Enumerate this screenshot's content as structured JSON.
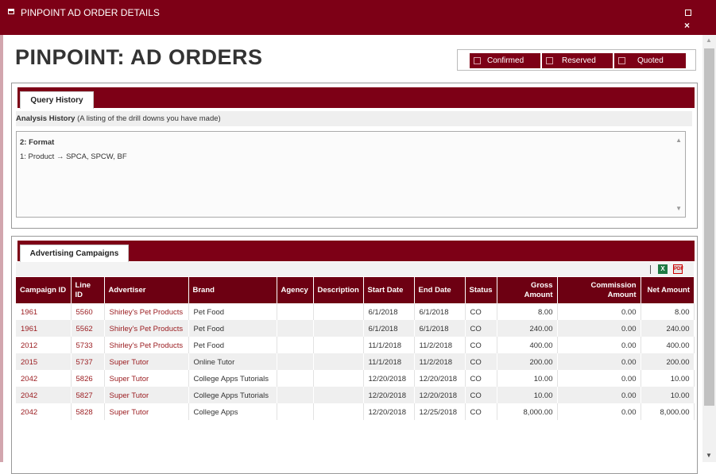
{
  "window": {
    "title": "PINPOINT AD ORDER DETAILS"
  },
  "page": {
    "title": "PINPOINT: AD ORDERS"
  },
  "legend": [
    {
      "label": "Confirmed"
    },
    {
      "label": "Reserved"
    },
    {
      "label": "Quoted"
    }
  ],
  "query_panel": {
    "tab_label": "Query History",
    "history_title": "Analysis History",
    "history_note": "(A listing of the drill downs you have made)",
    "items": [
      "2: Format",
      "1: Product  → SPCA, SPCW, BF"
    ]
  },
  "campaigns_panel": {
    "tab_label": "Advertising Campaigns",
    "export": {
      "excel_icon": "excel-icon",
      "pdf_icon": "pdf-icon",
      "excel_text": "X",
      "pdf_text": "PDF"
    },
    "columns": [
      "Campaign ID",
      "Line ID",
      "Advertiser",
      "Brand",
      "Agency",
      "Description",
      "Start Date",
      "End Date",
      "Status",
      "Gross Amount",
      "Commission Amount",
      "Net Amount"
    ],
    "rows": [
      {
        "campaign_id": "1961",
        "line_id": "5560",
        "advertiser": "Shirley's Pet Products",
        "brand": "Pet Food",
        "agency": "",
        "description": "",
        "start": "6/1/2018",
        "end": "6/1/2018",
        "status": "CO",
        "gross": "8.00",
        "commission": "0.00",
        "net": "8.00"
      },
      {
        "campaign_id": "1961",
        "line_id": "5562",
        "advertiser": "Shirley's Pet Products",
        "brand": "Pet Food",
        "agency": "",
        "description": "",
        "start": "6/1/2018",
        "end": "6/1/2018",
        "status": "CO",
        "gross": "240.00",
        "commission": "0.00",
        "net": "240.00"
      },
      {
        "campaign_id": "2012",
        "line_id": "5733",
        "advertiser": "Shirley's Pet Products",
        "brand": "Pet Food",
        "agency": "",
        "description": "",
        "start": "11/1/2018",
        "end": "11/2/2018",
        "status": "CO",
        "gross": "400.00",
        "commission": "0.00",
        "net": "400.00"
      },
      {
        "campaign_id": "2015",
        "line_id": "5737",
        "advertiser": "Super Tutor",
        "brand": "Online Tutor",
        "agency": "",
        "description": "",
        "start": "11/1/2018",
        "end": "11/2/2018",
        "status": "CO",
        "gross": "200.00",
        "commission": "0.00",
        "net": "200.00"
      },
      {
        "campaign_id": "2042",
        "line_id": "5826",
        "advertiser": "Super Tutor",
        "brand": "College Apps Tutorials",
        "agency": "",
        "description": "",
        "start": "12/20/2018",
        "end": "12/20/2018",
        "status": "CO",
        "gross": "10.00",
        "commission": "0.00",
        "net": "10.00"
      },
      {
        "campaign_id": "2042",
        "line_id": "5827",
        "advertiser": "Super Tutor",
        "brand": "College Apps Tutorials",
        "agency": "",
        "description": "",
        "start": "12/20/2018",
        "end": "12/20/2018",
        "status": "CO",
        "gross": "10.00",
        "commission": "0.00",
        "net": "10.00"
      },
      {
        "campaign_id": "2042",
        "line_id": "5828",
        "advertiser": "Super Tutor",
        "brand": "College Apps",
        "agency": "",
        "description": "",
        "start": "12/20/2018",
        "end": "12/25/2018",
        "status": "CO",
        "gross": "8,000.00",
        "commission": "0.00",
        "net": "8,000.00"
      }
    ]
  },
  "colors": {
    "brand": "#7d0016",
    "header_row": "#6d0012",
    "link": "#9a1a1e",
    "stripe": "#efefef"
  }
}
